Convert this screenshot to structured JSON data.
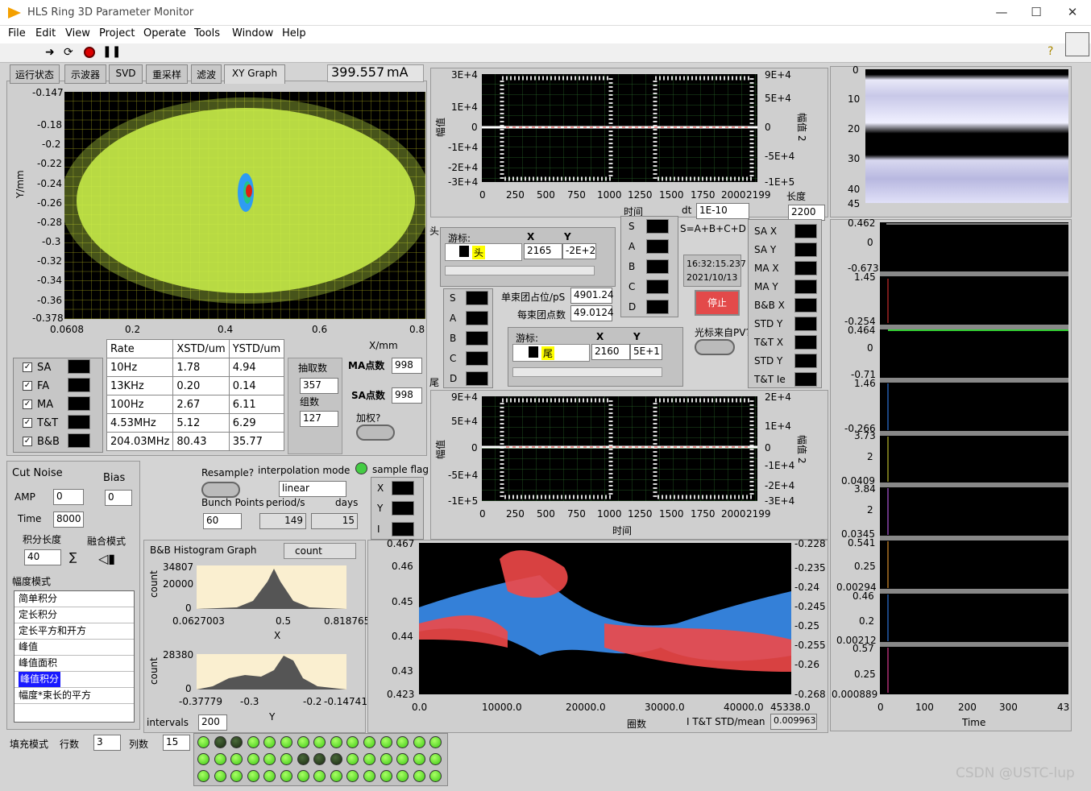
{
  "window": {
    "title": "HLS Ring 3D Parameter Monitor",
    "min": "—",
    "max": "☐",
    "close": "✕"
  },
  "menu": [
    "File",
    "Edit",
    "View",
    "Project",
    "Operate",
    "Tools",
    "Window",
    "Help"
  ],
  "tabs": [
    "运行状态",
    "示波器",
    "SVD",
    "重采样",
    "滤波",
    "XY Graph"
  ],
  "current": {
    "value": "399.557",
    "unit": "mA"
  },
  "xy": {
    "y_ticks": [
      "-0.147",
      "-0.18",
      "-0.2",
      "-0.22",
      "-0.24",
      "-0.26",
      "-0.28",
      "-0.3",
      "-0.32",
      "-0.34",
      "-0.36",
      "-0.378"
    ],
    "x_ticks": [
      "0.0608",
      "0.2",
      "0.4",
      "0.6",
      "0.8"
    ],
    "ylabel": "Y/mm",
    "xlabel": "X/mm"
  },
  "legend_items": [
    "SA",
    "FA",
    "MA",
    "T&T",
    "B&B"
  ],
  "stats": {
    "headers": [
      "Rate",
      "XSTD/um",
      "YSTD/um"
    ],
    "rows": [
      [
        "10Hz",
        "1.78",
        "4.94"
      ],
      [
        "13KHz",
        "0.20",
        "0.14"
      ],
      [
        "100Hz",
        "2.67",
        "6.11"
      ],
      [
        "4.53MHz",
        "5.12",
        "6.29"
      ],
      [
        "204.03MHz",
        "80.43",
        "35.77"
      ]
    ]
  },
  "sampling": {
    "count_label": "抽取数",
    "count": "357",
    "group_label": "组数",
    "group": "127",
    "ma_label": "MA点数",
    "ma": "998",
    "sa_label": "SA点数",
    "sa": "998",
    "weight_label": "加权?"
  },
  "wave1": {
    "yl": [
      "3E+4",
      "1E+4",
      "0",
      "-1E+4",
      "-2E+4",
      "-3E+4"
    ],
    "yr": [
      "9E+4",
      "5E+4",
      "0",
      "-5E+4",
      "-1E+5"
    ],
    "x": [
      "0",
      "250",
      "500",
      "750",
      "1000",
      "1250",
      "1500",
      "1750",
      "2000",
      "2199"
    ],
    "ylabel": "幅值",
    "ylabel2": "幅值 2",
    "xlabel": "时间"
  },
  "wave2": {
    "yl": [
      "9E+4",
      "5E+4",
      "0",
      "-5E+4",
      "-1E+5"
    ],
    "yr": [
      "2E+4",
      "1E+4",
      "0",
      "-1E+4",
      "-2E+4",
      "-3E+4"
    ],
    "x": [
      "0",
      "250",
      "500",
      "750",
      "1000",
      "1250",
      "1500",
      "1750",
      "2000",
      "2199"
    ],
    "ylabel": "幅值",
    "ylabel2": "幅值 2",
    "xlabel": "时间"
  },
  "dt": {
    "label": "dt",
    "value": "1E-10",
    "len_label": "长度",
    "len": "2200"
  },
  "cursor1": {
    "title": "游标:",
    "x": "X",
    "y": "Y",
    "name": "头",
    "xv": "2165",
    "yv": "-2E+2",
    "side": "头"
  },
  "cursor2": {
    "title": "游标:",
    "x": "X",
    "y": "Y",
    "name": "尾",
    "xv": "2160",
    "yv": "5E+1",
    "side": "尾"
  },
  "channels": [
    "S",
    "A",
    "B",
    "C",
    "D"
  ],
  "sum_label": "S=A+B+C+D",
  "time": {
    "clock": "16:32:15.237",
    "date": "2021/10/13"
  },
  "stop_label": "停止",
  "pv_label": "光标来自PV?",
  "bunch": {
    "pos_label": "单束团占位/pS",
    "pos": "4901.24",
    "pts_label": "每束团点数",
    "pts": "49.0124"
  },
  "right_legend": [
    "SA X",
    "SA Y",
    "MA X",
    "MA Y",
    "B&B X",
    "STD Y",
    "T&T X",
    "STD Y",
    "T&T Ie"
  ],
  "image": {
    "y": [
      "0",
      "10",
      "20",
      "30",
      "40",
      "45"
    ]
  },
  "strips": [
    [
      "0.462",
      "0",
      "-0.673"
    ],
    [
      "1.45",
      "",
      ""
    ],
    [
      "-0.254",
      "0.464",
      "0"
    ],
    [
      "-0.71",
      "1.46",
      ""
    ],
    [
      "-0.266",
      "3.73",
      "2"
    ],
    [
      "0.0409",
      "3.84",
      "2"
    ],
    [
      "0.0345",
      "0.541",
      "0.25"
    ],
    [
      "0.00294",
      "0.46",
      "0.2"
    ],
    [
      "0.00212",
      "0.57",
      "0.25"
    ],
    [
      "0.000889",
      "",
      ""
    ]
  ],
  "strip_x": [
    "0",
    "100",
    "200",
    "300",
    "43"
  ],
  "strip_xlabel": "Time",
  "cut": {
    "title": "Cut Noise",
    "bias": "Bias",
    "amp_label": "AMP",
    "amp": "0",
    "bias_val": "0",
    "time_label": "Time",
    "time": "8000",
    "int_label": "积分长度",
    "int": "40",
    "fuse_label": "融合模式",
    "sigma": "∑"
  },
  "amp_mode": {
    "title": "幅度模式",
    "items": [
      "简单积分",
      "定长积分",
      "定长平方和开方",
      "峰值",
      "峰值面积",
      "峰值积分",
      "幅度*束长的平方"
    ],
    "selected": 5
  },
  "resample": {
    "label": "Resample?",
    "interp_label": "interpolation mode",
    "interp": "linear",
    "flag_label": "sample flag",
    "bp_label": "Bunch Points",
    "period_label": "period/s",
    "days_label": "days",
    "bp": "60",
    "period": "149",
    "days": "15"
  },
  "xyi": [
    "X",
    "Y",
    "I"
  ],
  "hist": {
    "title": "B&B Histogram Graph",
    "count_btn": "count",
    "h1_ymax": "34807",
    "h1_ymid": "20000",
    "h1_y0": "0",
    "h1_x": [
      "0.0627003",
      "0.5",
      "0.818765"
    ],
    "h1_xlabel": "X",
    "h2_ymax": "28380",
    "h2_y0": "0",
    "h2_x": [
      "-0.37779",
      "-0.3",
      "-0.2",
      "-0.147414"
    ],
    "h2_xlabel": "Y",
    "ylabel": "count",
    "intervals_label": "intervals",
    "intervals": "200"
  },
  "trend": {
    "yl": [
      "0.467",
      "0.46",
      "0.45",
      "0.44",
      "0.43",
      "0.423"
    ],
    "yr": [
      "-0.228",
      "-0.235",
      "-0.24",
      "-0.245",
      "-0.25",
      "-0.255",
      "-0.26",
      "-0.268"
    ],
    "x": [
      "0.0",
      "10000.0",
      "20000.0",
      "30000.0",
      "40000.0",
      "45338.0"
    ],
    "xlabel": "圈数",
    "footer": "I T&T STD/mean",
    "val": "0.009963"
  },
  "fill": {
    "label": "填充模式",
    "rows_label": "行数",
    "rows": "3",
    "cols_label": "列数",
    "cols": "15"
  },
  "leds": [
    1,
    0,
    0,
    1,
    1,
    1,
    1,
    1,
    1,
    1,
    1,
    1,
    1,
    1,
    1,
    1,
    1,
    1,
    1,
    1,
    1,
    0,
    0,
    0,
    1,
    1,
    1,
    1,
    1,
    1,
    1,
    1,
    1,
    1,
    1,
    1,
    1,
    1,
    1,
    1,
    1,
    1,
    1,
    1,
    1
  ],
  "watermark": "CSDN @USTC-lup"
}
